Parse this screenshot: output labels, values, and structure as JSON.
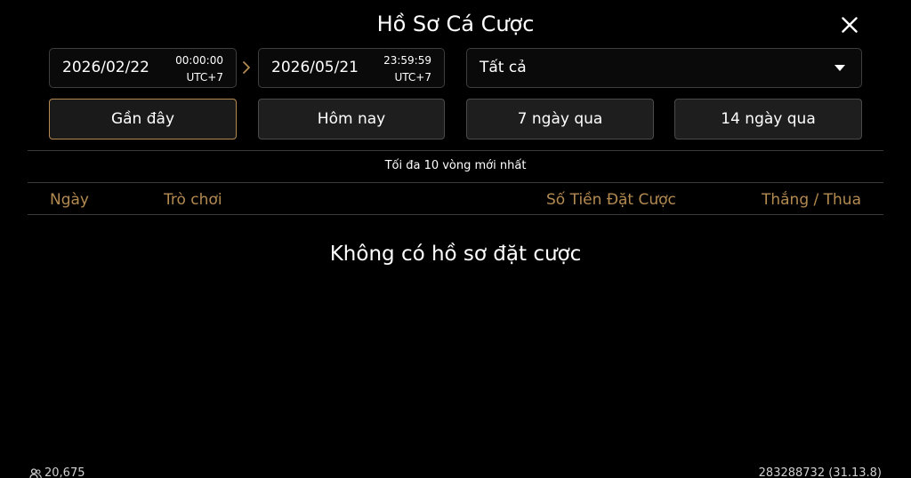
{
  "header": {
    "title": "Hồ Sơ Cá Cược"
  },
  "filters": {
    "start": {
      "date": "2026/02/22",
      "time": "00:00:00",
      "tz": "UTC+7"
    },
    "end": {
      "date": "2026/05/21",
      "time": "23:59:59",
      "tz": "UTC+7"
    },
    "game_select": {
      "value": "Tất cả"
    }
  },
  "quick_ranges": [
    {
      "label": "Gần đây",
      "active": true
    },
    {
      "label": "Hôm nay",
      "active": false
    },
    {
      "label": "7 ngày qua",
      "active": false
    },
    {
      "label": "14 ngày qua",
      "active": false
    }
  ],
  "limit_note": "Tối đa 10 vòng mới nhất",
  "table": {
    "columns": [
      "Ngày",
      "Trò chơi",
      "Số Tiền Đặt Cược",
      "Thắng / Thua"
    ]
  },
  "empty_message": "Không có hồ sơ đặt cược",
  "footer": {
    "players": "20,675",
    "build": "283288732 (31.13.8)"
  },
  "colors": {
    "accent": "#b38a50",
    "background": "#000000",
    "button_bg": "#1e1e1e"
  },
  "icons": {
    "close": "close-icon",
    "arrow": "chevron-right-icon",
    "caret": "caret-down-icon",
    "players": "users-icon"
  }
}
